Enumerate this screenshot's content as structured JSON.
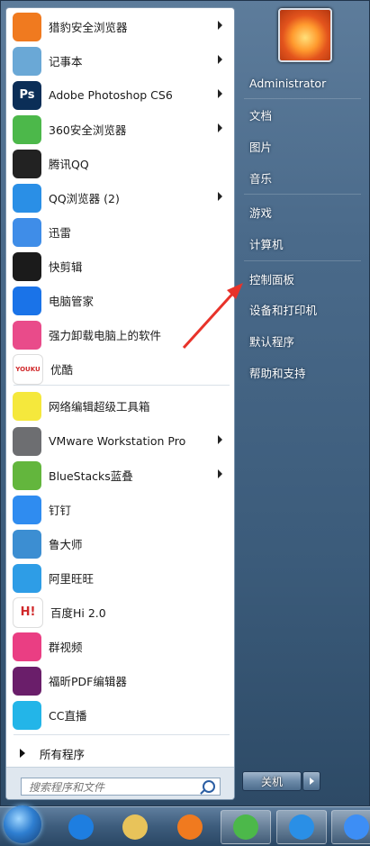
{
  "programs": [
    {
      "label": "猎豹安全浏览器",
      "icon": "cheetah-browser-icon",
      "color": "#f07a1f",
      "arrow": true
    },
    {
      "label": "记事本",
      "icon": "notepad-icon",
      "color": "#6aa8d6",
      "arrow": true
    },
    {
      "label": "Adobe Photoshop CS6",
      "icon": "photoshop-icon",
      "color": "#0b2e57",
      "arrow": true,
      "text": "Ps"
    },
    {
      "label": "360安全浏览器",
      "icon": "360-browser-icon",
      "color": "#4cb84a",
      "arrow": true
    },
    {
      "label": "腾讯QQ",
      "icon": "qq-icon",
      "color": "#222222",
      "arrow": false
    },
    {
      "label": "QQ浏览器 (2)",
      "icon": "qq-browser-icon",
      "color": "#2a8fe6",
      "arrow": true
    },
    {
      "label": "迅雷",
      "icon": "xunlei-icon",
      "color": "#3f8de8",
      "arrow": false
    },
    {
      "label": "快剪辑",
      "icon": "kuaijianji-icon",
      "color": "#1b1b1b",
      "arrow": false
    },
    {
      "label": "电脑管家",
      "icon": "pc-manager-icon",
      "color": "#1a73e8",
      "arrow": false
    },
    {
      "label": "强力卸载电脑上的软件",
      "icon": "uninstaller-icon",
      "color": "#e94b8a",
      "arrow": false
    },
    {
      "label": "优酷",
      "icon": "youku-icon",
      "color": "#ffffff",
      "arrow": false,
      "text": "YOUKU"
    },
    {
      "label": "网络编辑超级工具箱",
      "icon": "toolbox-icon",
      "color": "#f5e83c",
      "arrow": false
    },
    {
      "label": "VMware Workstation Pro",
      "icon": "vmware-icon",
      "color": "#6d6e71",
      "arrow": true
    },
    {
      "label": "BlueStacks蓝叠",
      "icon": "bluestacks-icon",
      "color": "#63b63d",
      "arrow": true
    },
    {
      "label": "钉钉",
      "icon": "dingtalk-icon",
      "color": "#2f8cf0",
      "arrow": false
    },
    {
      "label": "鲁大师",
      "icon": "ludashi-icon",
      "color": "#3c8ed2",
      "arrow": false
    },
    {
      "label": "阿里旺旺",
      "icon": "aliwangwang-icon",
      "color": "#2e9de6",
      "arrow": false
    },
    {
      "label": "百度Hi 2.0",
      "icon": "baidu-hi-icon",
      "color": "#ffffff",
      "arrow": false,
      "text": "H!"
    },
    {
      "label": "群视频",
      "icon": "group-video-icon",
      "color": "#ea3e83",
      "arrow": false
    },
    {
      "label": "福昕PDF编辑器",
      "icon": "foxit-pdf-icon",
      "color": "#6a1e6a",
      "arrow": false
    },
    {
      "label": "CC直播",
      "icon": "cc-live-icon",
      "color": "#23b5e8",
      "arrow": false
    }
  ],
  "all_programs": "所有程序",
  "search": {
    "placeholder": "搜索程序和文件"
  },
  "right_items": [
    {
      "label": "Administrator",
      "name": "user-name"
    },
    {
      "label": "文档",
      "name": "right-item-documents"
    },
    {
      "label": "图片",
      "name": "right-item-pictures"
    },
    {
      "label": "音乐",
      "name": "right-item-music"
    },
    {
      "label": "游戏",
      "name": "right-item-games"
    },
    {
      "label": "计算机",
      "name": "right-item-computer"
    },
    {
      "label": "控制面板",
      "name": "right-item-control-panel"
    },
    {
      "label": "设备和打印机",
      "name": "right-item-devices-printers"
    },
    {
      "label": "默认程序",
      "name": "right-item-default-programs"
    },
    {
      "label": "帮助和支持",
      "name": "right-item-help-support"
    }
  ],
  "shutdown": {
    "label": "关机"
  },
  "annotation": {
    "color": "#e8332a"
  },
  "taskbar": [
    {
      "name": "ie-taskbar-icon",
      "color": "#1e7ee0"
    },
    {
      "name": "explorer-taskbar-icon",
      "color": "#e8c35a"
    },
    {
      "name": "cheetah-taskbar-icon",
      "color": "#f07a1f"
    },
    {
      "name": "360-taskbar-icon",
      "color": "#4cb84a"
    },
    {
      "name": "qq-browser-taskbar-icon",
      "color": "#2a8fe6"
    },
    {
      "name": "baidu-netdisk-taskbar-icon",
      "color": "#3d8ef5"
    }
  ]
}
